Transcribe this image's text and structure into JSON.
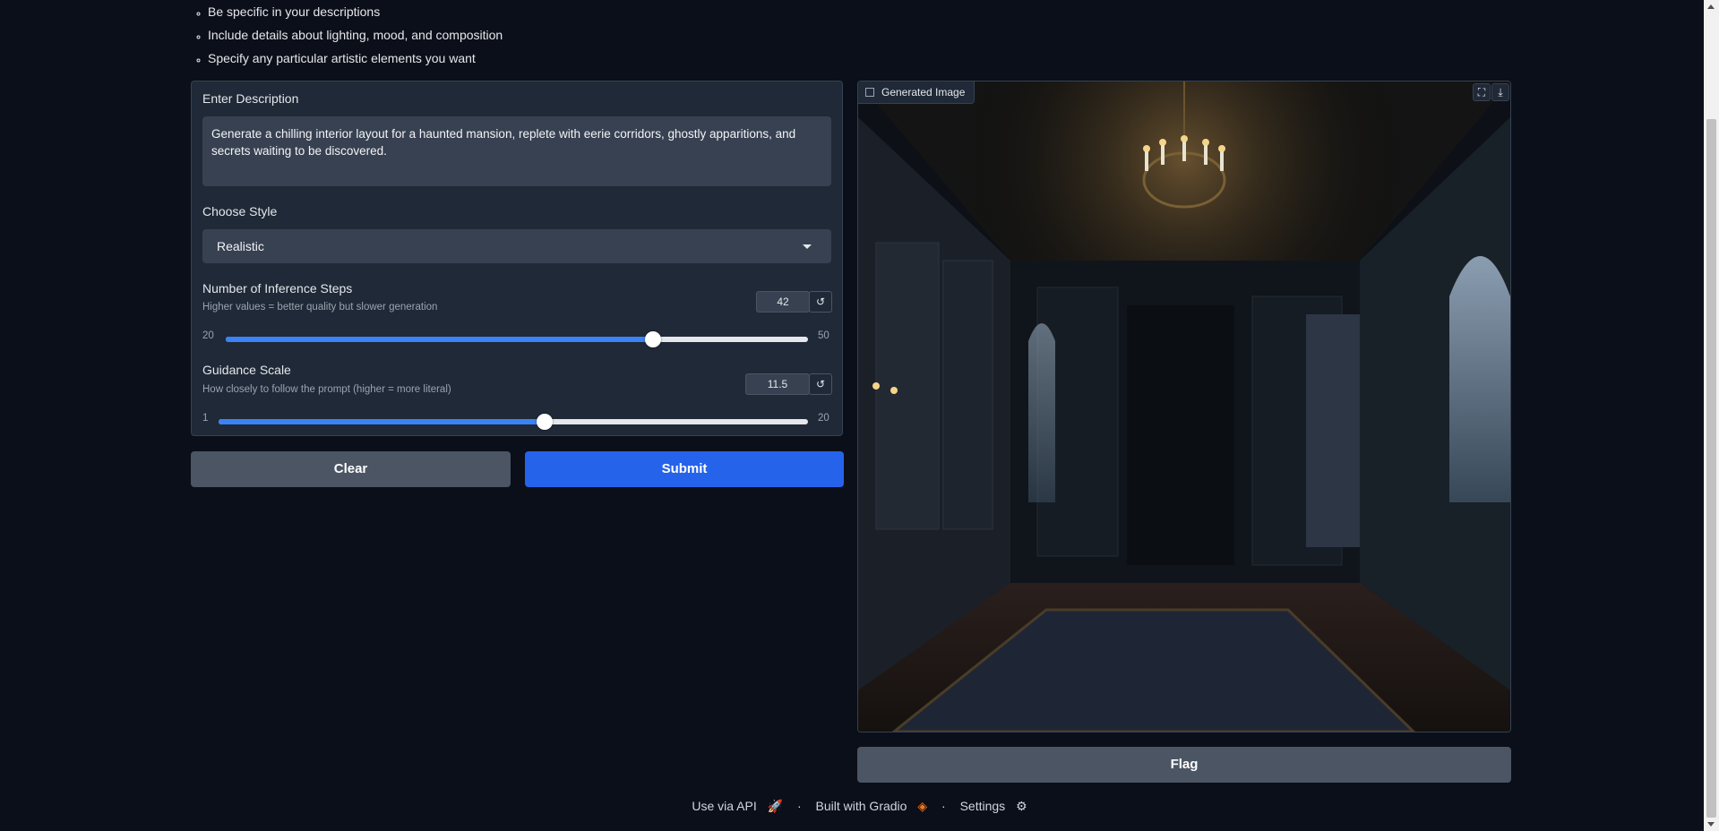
{
  "tips": [
    "Be specific in your descriptions",
    "Include details about lighting, mood, and composition",
    "Specify any particular artistic elements you want"
  ],
  "description": {
    "label": "Enter Description",
    "value": "Generate a chilling interior layout for a haunted mansion, replete with eerie corridors, ghostly apparitions, and secrets waiting to be discovered."
  },
  "style": {
    "label": "Choose Style",
    "selected": "Realistic"
  },
  "steps": {
    "label": "Number of Inference Steps",
    "info": "Higher values = better quality but slower generation",
    "value": "42",
    "min": "20",
    "max": "50",
    "fraction": 0.7333
  },
  "guidance": {
    "label": "Guidance Scale",
    "info": "How closely to follow the prompt (higher = more literal)",
    "value": "11.5",
    "min": "1",
    "max": "20",
    "fraction": 0.5526
  },
  "buttons": {
    "clear": "Clear",
    "submit": "Submit",
    "flag": "Flag"
  },
  "output": {
    "label": "Generated Image"
  },
  "footer": {
    "api": "Use via API",
    "built": "Built with Gradio",
    "settings": "Settings",
    "sep": "·"
  },
  "colors": {
    "accent": "#2563eb",
    "slider": "#3b82f6",
    "background": "#0b0f19"
  }
}
